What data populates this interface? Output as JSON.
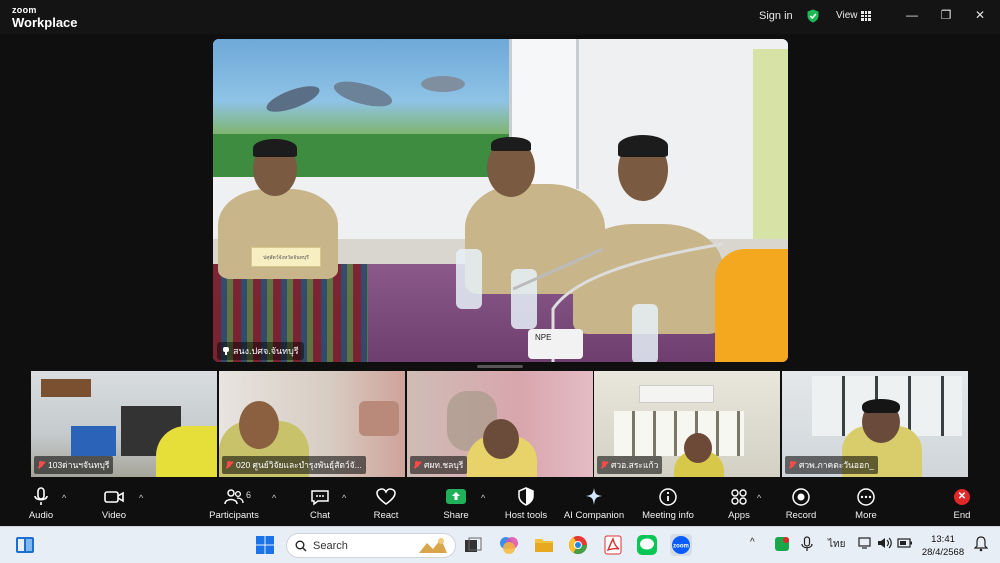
{
  "app": {
    "logo_top": "zoom",
    "logo_bottom": "Workplace",
    "signin_label": "Sign in",
    "view_label": "View",
    "minimize_glyph": "—",
    "restore_glyph": "❐",
    "close_glyph": "✕"
  },
  "main_video": {
    "participant_name": "สนง.ปศจ.จันทบุรี",
    "sign_text": "ปศุสัตว์จังหวัดจันทบุรี",
    "mic_label": "NPE"
  },
  "gallery": [
    {
      "name": "103ด่านฯจันทบุรี",
      "muted": true
    },
    {
      "name": "020 ศูนย์วิจัยและบำรุงพันธุ์สัตว์จั...",
      "muted": true
    },
    {
      "name": "ศผท.ชลบุรี",
      "muted": true
    },
    {
      "name": "ศวอ.สระแก้ว",
      "muted": true
    },
    {
      "name": "ศวพ.ภาคตะวันออก_",
      "muted": true
    }
  ],
  "toolbar": {
    "audio": "Audio",
    "video": "Video",
    "participants": "Participants",
    "participants_count": "6",
    "chat": "Chat",
    "react": "React",
    "share": "Share",
    "host_tools": "Host tools",
    "ai_companion": "AI Companion",
    "meeting_info": "Meeting info",
    "apps": "Apps",
    "record": "Record",
    "more": "More",
    "end": "End"
  },
  "taskbar": {
    "search_placeholder": "Search",
    "lang": "ไทย",
    "time": "13:41",
    "date": "28/4/2568"
  },
  "colors": {
    "app_bg": "#0f0f0f",
    "share_green": "#1fb05a",
    "end_red": "#e02828",
    "shield_green": "#1db954",
    "taskbar_bg": "#e8eef5"
  }
}
